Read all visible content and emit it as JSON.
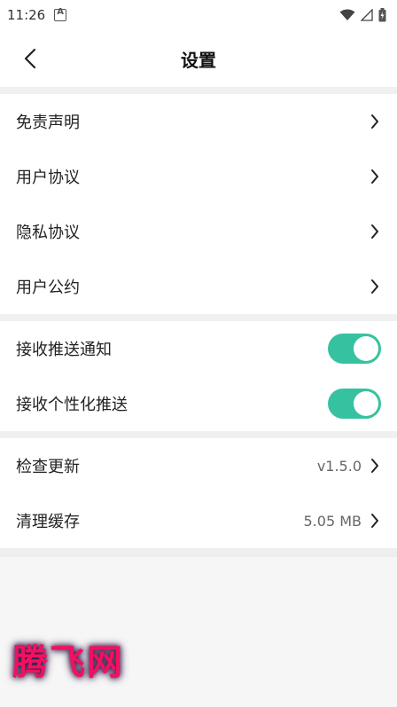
{
  "status_bar": {
    "time": "11:26"
  },
  "header": {
    "title": "设置"
  },
  "groups": [
    {
      "items": [
        {
          "label": "免责声明"
        },
        {
          "label": "用户协议"
        },
        {
          "label": "隐私协议"
        },
        {
          "label": "用户公约"
        }
      ]
    },
    {
      "items": [
        {
          "label": "接收推送通知",
          "toggle_on": true
        },
        {
          "label": "接收个性化推送",
          "toggle_on": true
        }
      ]
    },
    {
      "items": [
        {
          "label": "检查更新",
          "value": "v1.5.0"
        },
        {
          "label": "清理缓存",
          "value": "5.05 MB"
        }
      ]
    }
  ],
  "watermark": {
    "text": "腾飞网"
  },
  "colors": {
    "toggle_on": "#36c2a0",
    "watermark": "#f21060"
  }
}
